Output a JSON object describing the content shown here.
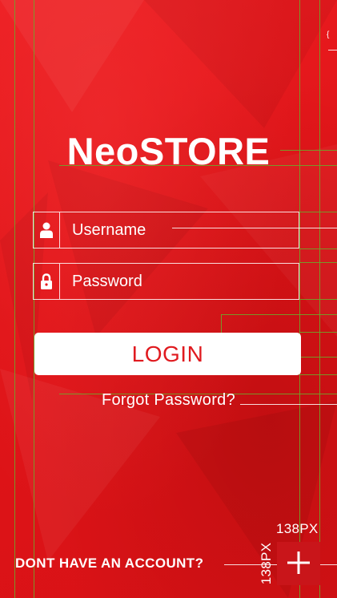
{
  "app": {
    "brand": "NeoSTORE"
  },
  "login_form": {
    "username_placeholder": "Username",
    "password_placeholder": "Password",
    "login_label": "LOGIN",
    "forgot_label": "Forgot Password?"
  },
  "footer": {
    "signup_prompt": "DONT HAVE AN ACCOUNT?",
    "dimension_width_label": "138PX",
    "dimension_height_label": "138PX",
    "corner_mark": "{"
  },
  "icons": {
    "username": "user-icon",
    "password": "lock-icon",
    "add": "plus-icon"
  },
  "colors": {
    "background": "#e8191c",
    "button_bg": "#ffffff",
    "button_text": "#e01a1f",
    "guide": "#6fa52a"
  }
}
